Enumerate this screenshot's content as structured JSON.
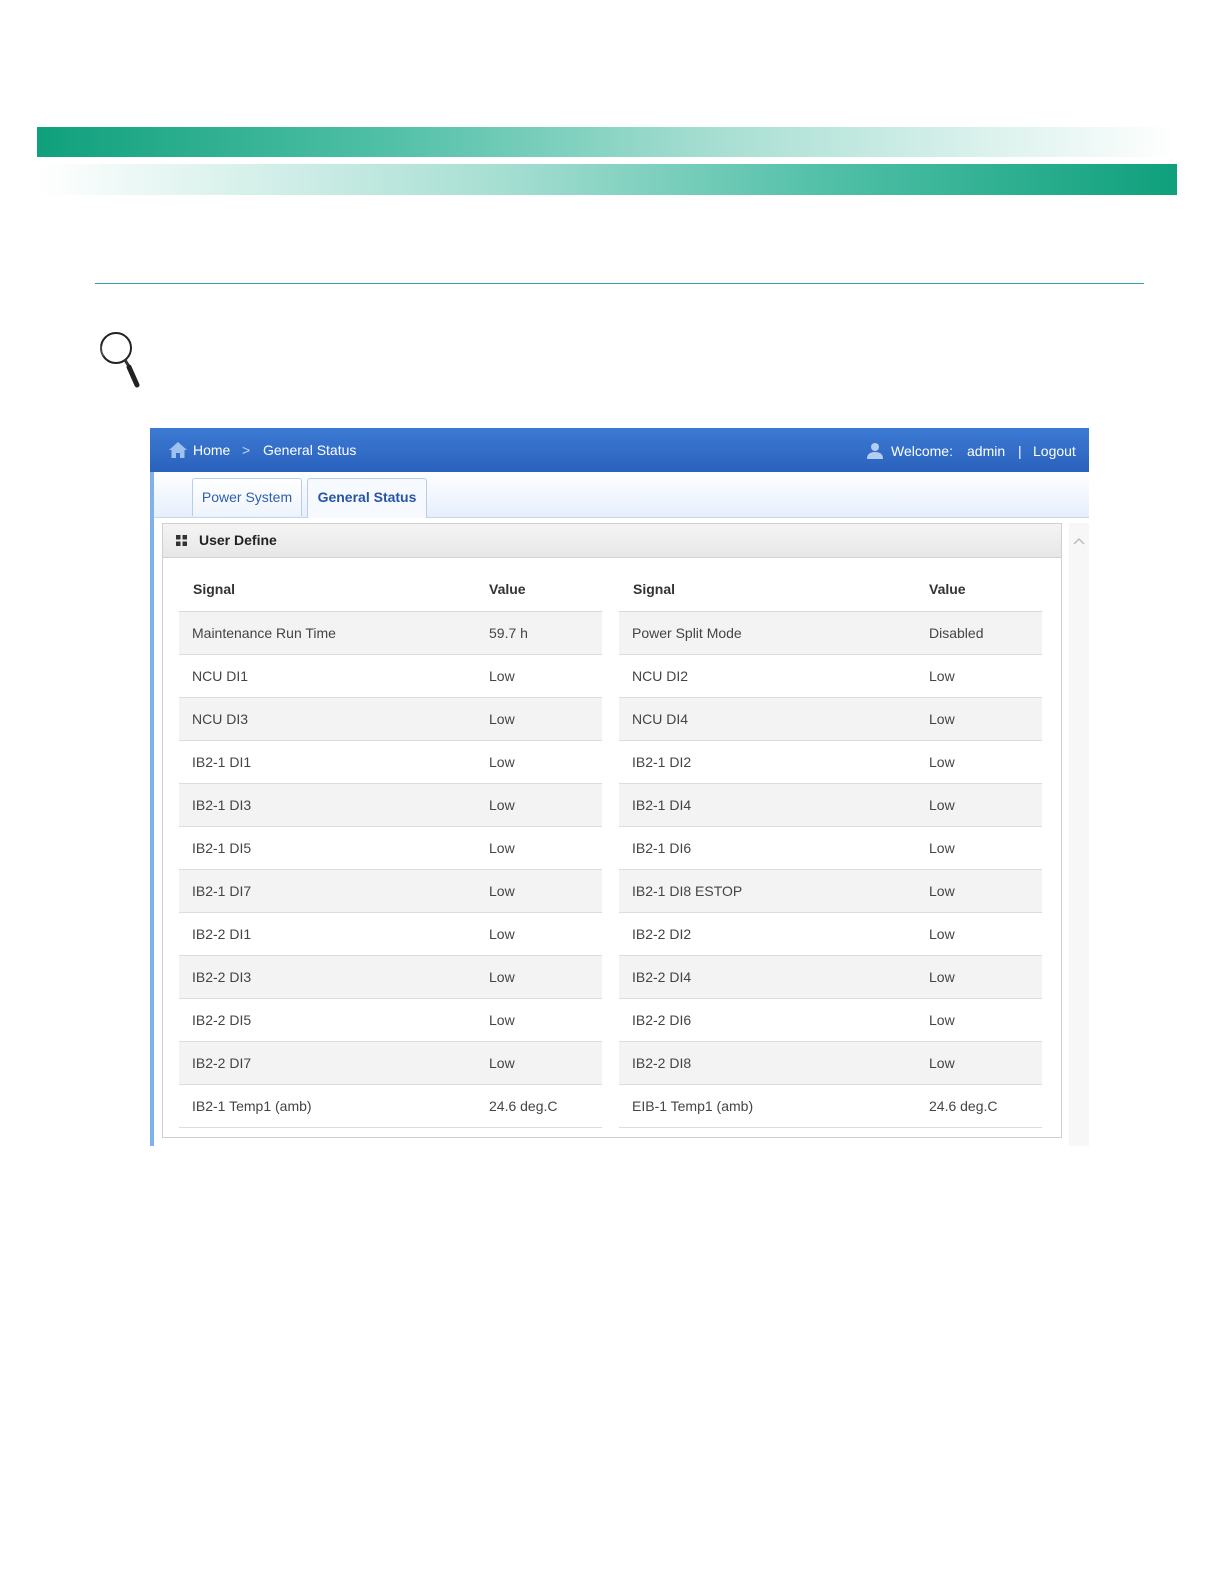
{
  "colors": {
    "header_band": "#0fa07c",
    "nav_bar": "#2a62bd",
    "tab_text": "#2d5fb0",
    "rule": "#3a9fa7"
  },
  "nav": {
    "home_icon": "home-icon",
    "home": "Home",
    "separator": ">",
    "current": "General Status",
    "user_icon": "user-icon",
    "welcome": "Welcome:",
    "username": "admin",
    "divider": "|",
    "logout": "Logout"
  },
  "tabs": [
    {
      "label": "Power System",
      "active": false
    },
    {
      "label": "General Status",
      "active": true
    }
  ],
  "panel": {
    "icon": "grid-icon",
    "title": "User Define"
  },
  "table": {
    "headers": {
      "signal": "Signal",
      "value": "Value"
    },
    "left": [
      {
        "signal": "Maintenance Run Time",
        "value": "59.7 h"
      },
      {
        "signal": "NCU DI1",
        "value": "Low"
      },
      {
        "signal": "NCU DI3",
        "value": "Low"
      },
      {
        "signal": "IB2-1 DI1",
        "value": "Low"
      },
      {
        "signal": "IB2-1 DI3",
        "value": "Low"
      },
      {
        "signal": "IB2-1 DI5",
        "value": "Low"
      },
      {
        "signal": "IB2-1 DI7",
        "value": "Low"
      },
      {
        "signal": "IB2-2 DI1",
        "value": "Low"
      },
      {
        "signal": "IB2-2 DI3",
        "value": "Low"
      },
      {
        "signal": "IB2-2 DI5",
        "value": "Low"
      },
      {
        "signal": "IB2-2 DI7",
        "value": "Low"
      },
      {
        "signal": "IB2-1 Temp1 (amb)",
        "value": "24.6 deg.C"
      }
    ],
    "right": [
      {
        "signal": "Power Split Mode",
        "value": "Disabled"
      },
      {
        "signal": "NCU DI2",
        "value": "Low"
      },
      {
        "signal": "NCU DI4",
        "value": "Low"
      },
      {
        "signal": "IB2-1 DI2",
        "value": "Low"
      },
      {
        "signal": "IB2-1 DI4",
        "value": "Low"
      },
      {
        "signal": "IB2-1 DI6",
        "value": "Low"
      },
      {
        "signal": "IB2-1 DI8 ESTOP",
        "value": "Low"
      },
      {
        "signal": "IB2-2 DI2",
        "value": "Low"
      },
      {
        "signal": "IB2-2 DI4",
        "value": "Low"
      },
      {
        "signal": "IB2-2 DI6",
        "value": "Low"
      },
      {
        "signal": "IB2-2 DI8",
        "value": "Low"
      },
      {
        "signal": "EIB-1 Temp1 (amb)",
        "value": "24.6 deg.C"
      }
    ]
  }
}
